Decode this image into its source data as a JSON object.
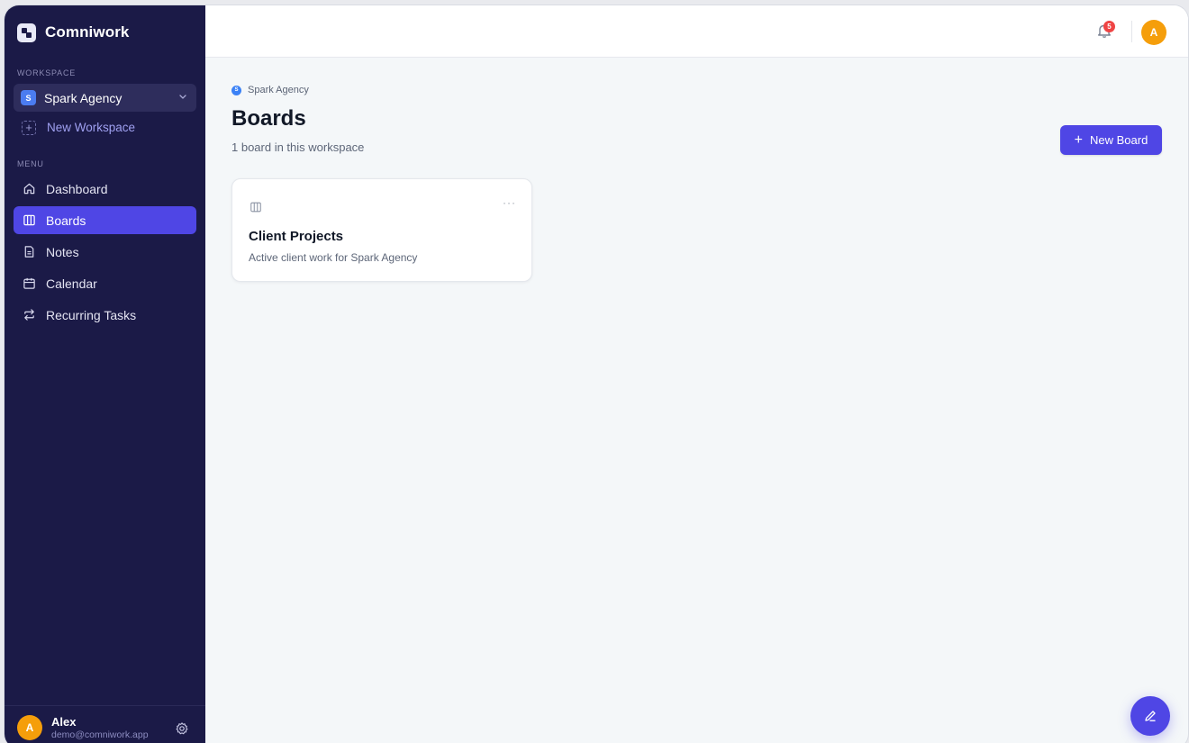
{
  "app": {
    "name": "Comniwork"
  },
  "sidebar": {
    "workspace_label": "WORKSPACE",
    "workspace": {
      "badge": "S",
      "name": "Spark Agency"
    },
    "new_workspace_label": "New Workspace",
    "menu_label": "MENU",
    "items": [
      {
        "label": "Dashboard",
        "icon": "home-icon",
        "active": false
      },
      {
        "label": "Boards",
        "icon": "board-icon",
        "active": true
      },
      {
        "label": "Notes",
        "icon": "note-icon",
        "active": false
      },
      {
        "label": "Calendar",
        "icon": "calendar-icon",
        "active": false
      },
      {
        "label": "Recurring Tasks",
        "icon": "repeat-icon",
        "active": false
      }
    ],
    "user": {
      "initial": "A",
      "name": "Alex",
      "email": "demo@comniwork.app"
    }
  },
  "topbar": {
    "notification_count": "5",
    "avatar_initial": "A"
  },
  "main": {
    "breadcrumb": {
      "badge": "S",
      "text": "Spark Agency"
    },
    "title": "Boards",
    "subtitle": "1 board in this workspace",
    "new_board_label": "New Board",
    "boards": [
      {
        "title": "Client Projects",
        "description": "Active client work for Spark Agency",
        "more": "···"
      }
    ]
  },
  "colors": {
    "sidebar_bg": "#1b1a47",
    "accent": "#4f46e5",
    "avatar": "#f59e0b",
    "workspace_badge": "#4b7cf0",
    "notification": "#ef4444"
  }
}
